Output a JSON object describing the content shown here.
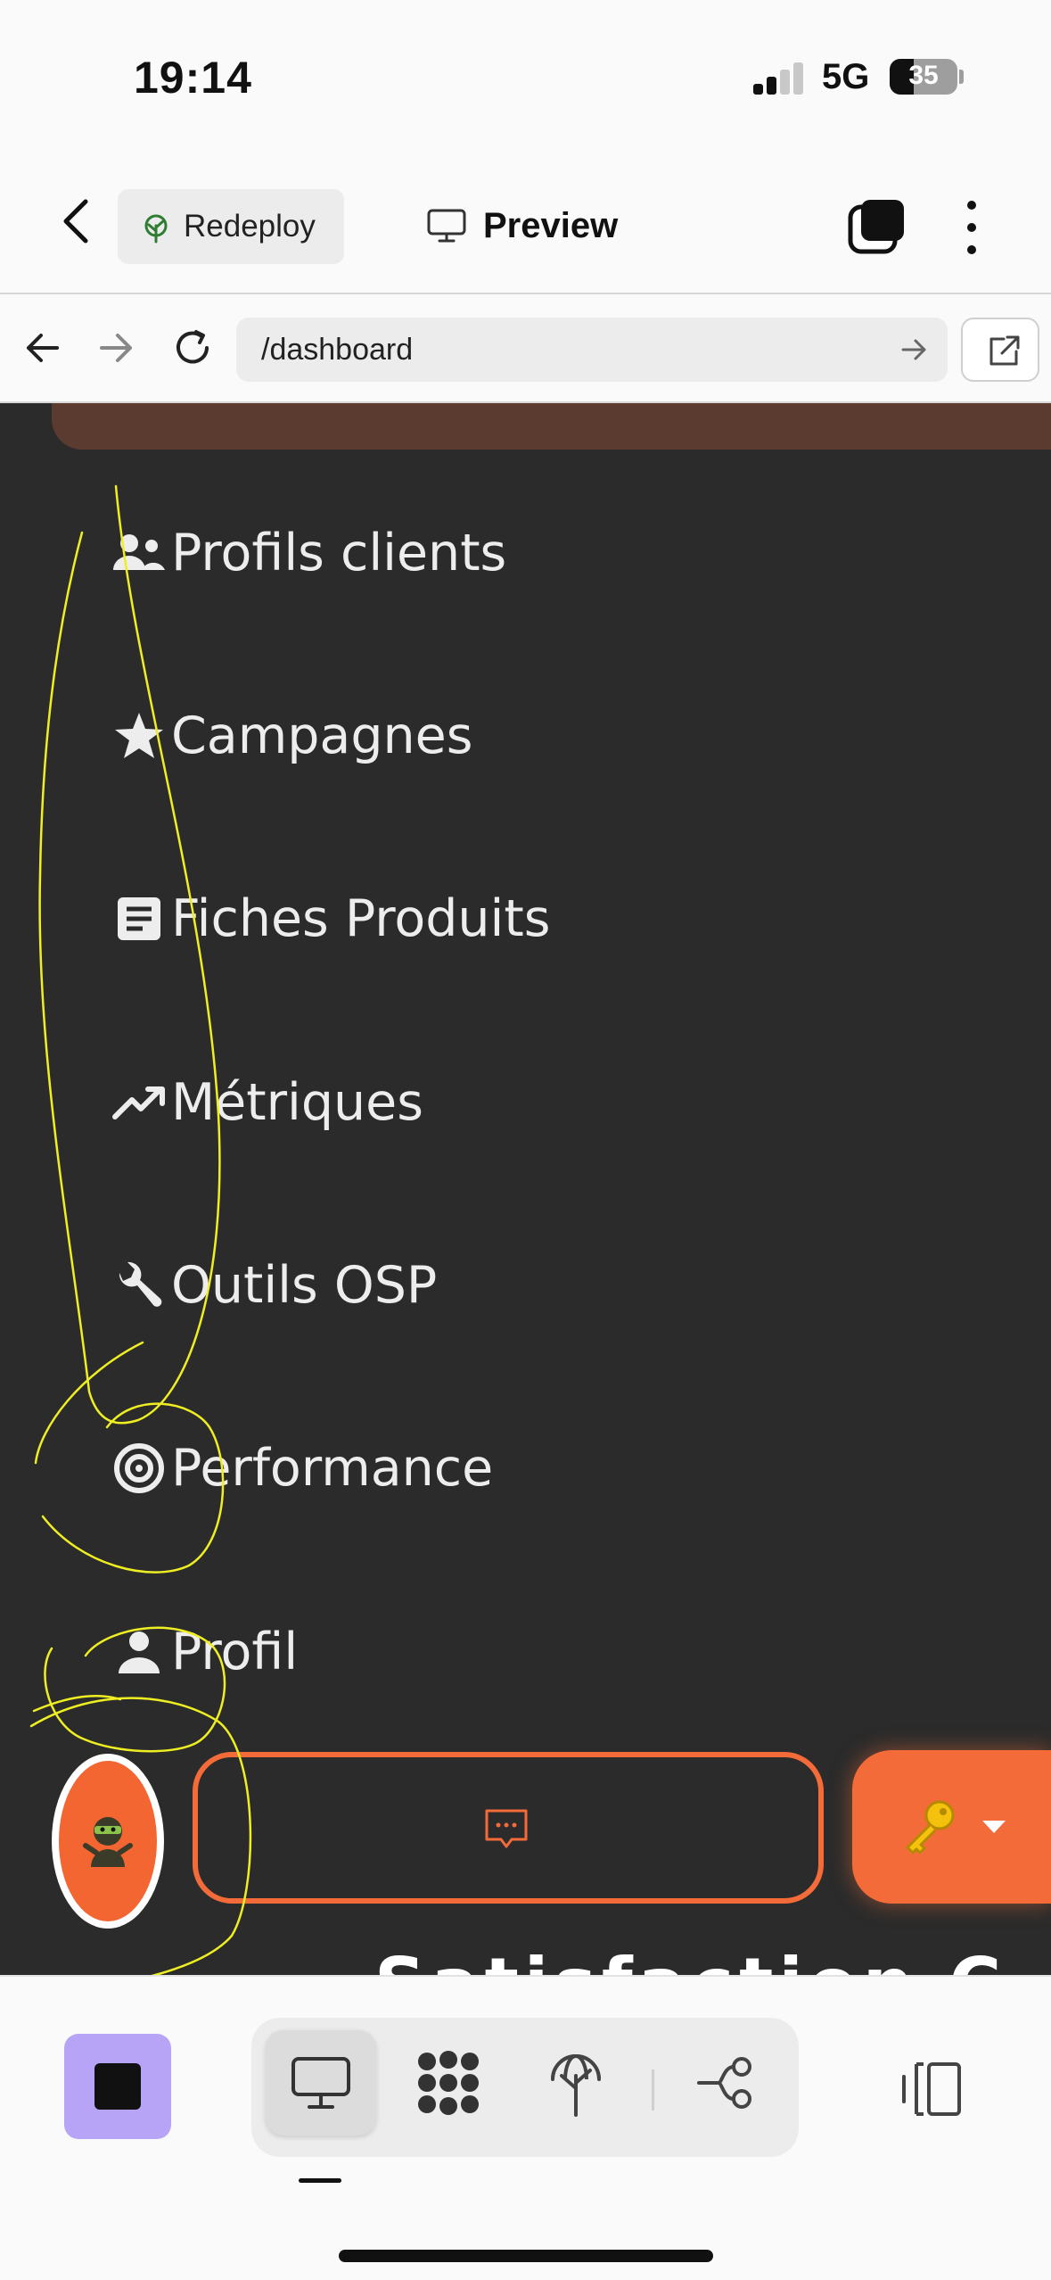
{
  "status_bar": {
    "time": "19:14",
    "network": "5G",
    "battery": "35"
  },
  "app_bar": {
    "redeploy_label": "Redeploy",
    "preview_label": "Preview"
  },
  "browser": {
    "url": "/dashboard"
  },
  "nav": {
    "items": [
      {
        "label": "Profils clients",
        "icon": "users-icon"
      },
      {
        "label": "Campagnes",
        "icon": "star-icon"
      },
      {
        "label": "Fiches Produits",
        "icon": "document-icon"
      },
      {
        "label": "Métriques",
        "icon": "trending-up-icon"
      },
      {
        "label": "Outils OSP",
        "icon": "wrench-icon"
      },
      {
        "label": "Performance",
        "icon": "target-icon"
      },
      {
        "label": "Profil",
        "icon": "person-icon"
      }
    ]
  },
  "chat": {
    "avatar_icon": "ninja-avatar-icon",
    "key_icon": "key-icon"
  },
  "peek_heading": "Satisfaction C",
  "colors": {
    "accent_orange": "#f46b3a",
    "dark_bg": "#2b2b2b",
    "card_brown": "#5b3a30",
    "stop_purple": "#b7a4f7",
    "annotation_yellow": "#f0f000"
  }
}
